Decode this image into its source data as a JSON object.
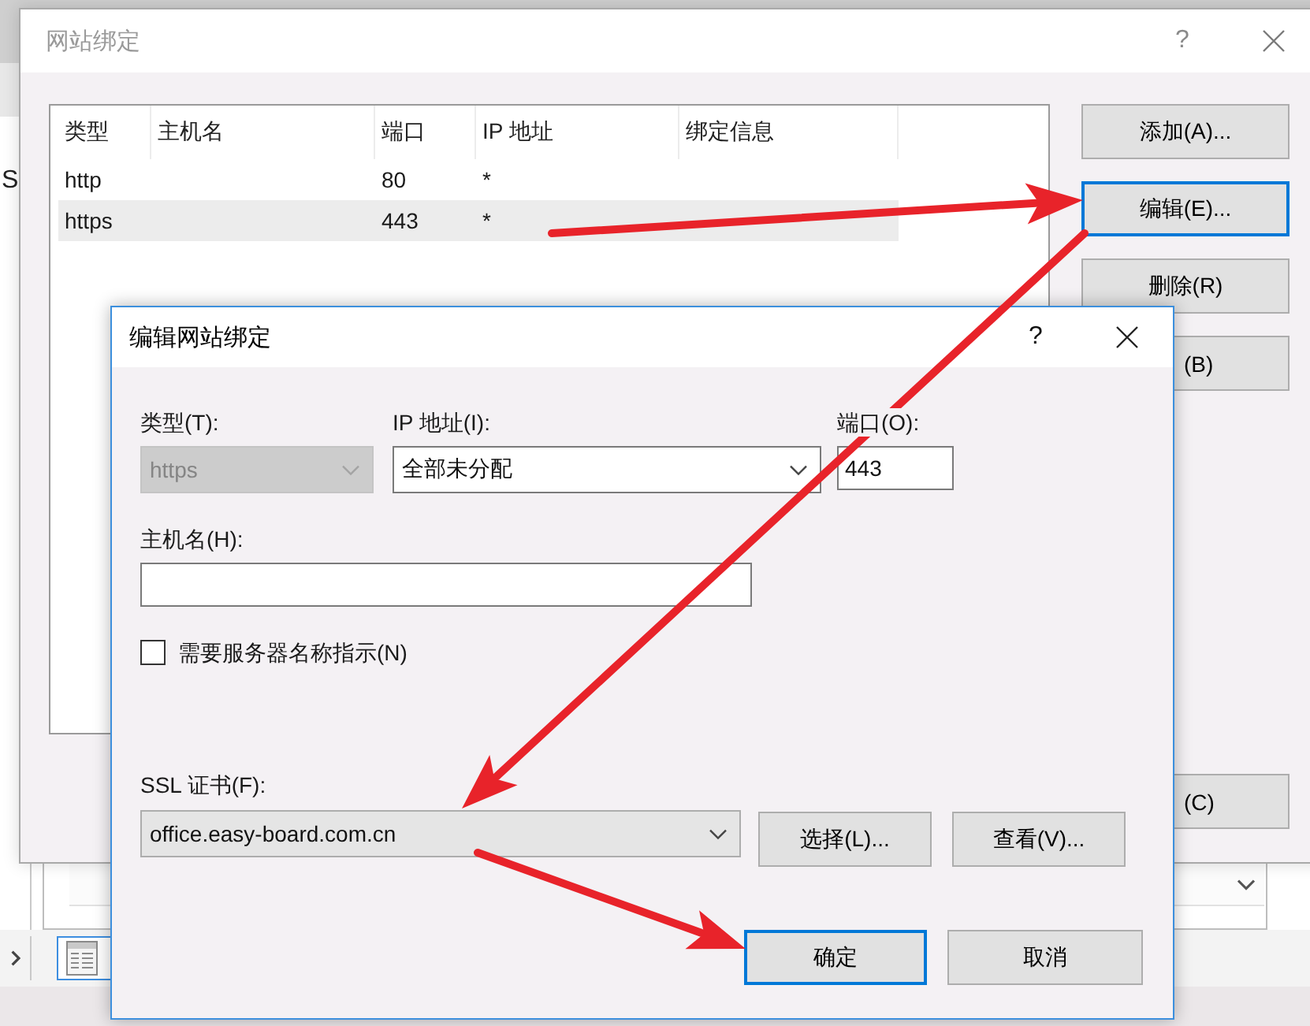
{
  "background_window": {
    "pane_text": "S"
  },
  "bindings_dialog": {
    "title": "网站绑定",
    "active": false,
    "help": "?",
    "table": {
      "columns": [
        "类型",
        "主机名",
        "端口",
        "IP 地址",
        "绑定信息"
      ],
      "rows": [
        {
          "type": "http",
          "port": "80",
          "ip_address": "*",
          "selected": false
        },
        {
          "type": "https",
          "port": "443",
          "ip_address": "*",
          "selected": true
        }
      ]
    },
    "buttons": [
      {
        "label": "添加(A)...",
        "focused": false,
        "clipped": false
      },
      {
        "label": "编辑(E)...",
        "focused": true,
        "clipped": false
      },
      {
        "label": "删除(R)",
        "focused": false,
        "clipped": false
      },
      {
        "label": "(B)",
        "focused": false,
        "clipped": true
      }
    ],
    "close_button": {
      "label": "(C)",
      "clipped": true
    }
  },
  "edit_dialog": {
    "title": "编辑网站绑定",
    "active": true,
    "help": "?",
    "type_field": {
      "label": "类型(T):",
      "value": "https",
      "disabled": true
    },
    "ip_field": {
      "label": "IP 地址(I):",
      "value": "全部未分配",
      "disabled": false,
      "editable": true
    },
    "port_field": {
      "label": "端口(O):",
      "value": "443"
    },
    "host_field": {
      "label": "主机名(H):"
    },
    "sni_checkbox": {
      "label": "需要服务器名称指示(N)",
      "checked": false
    },
    "ssl_field": {
      "label": "SSL 证书(F):",
      "value": "office.easy-board.com.cn",
      "disabled": false,
      "editable": false
    },
    "ssl_buttons": [
      {
        "label": "选择(L)...",
        "focused": false
      },
      {
        "label": "查看(V)...",
        "focused": false
      }
    ],
    "footer_buttons": [
      {
        "label": "确定",
        "focused": true
      },
      {
        "label": "取消",
        "focused": false
      }
    ]
  }
}
